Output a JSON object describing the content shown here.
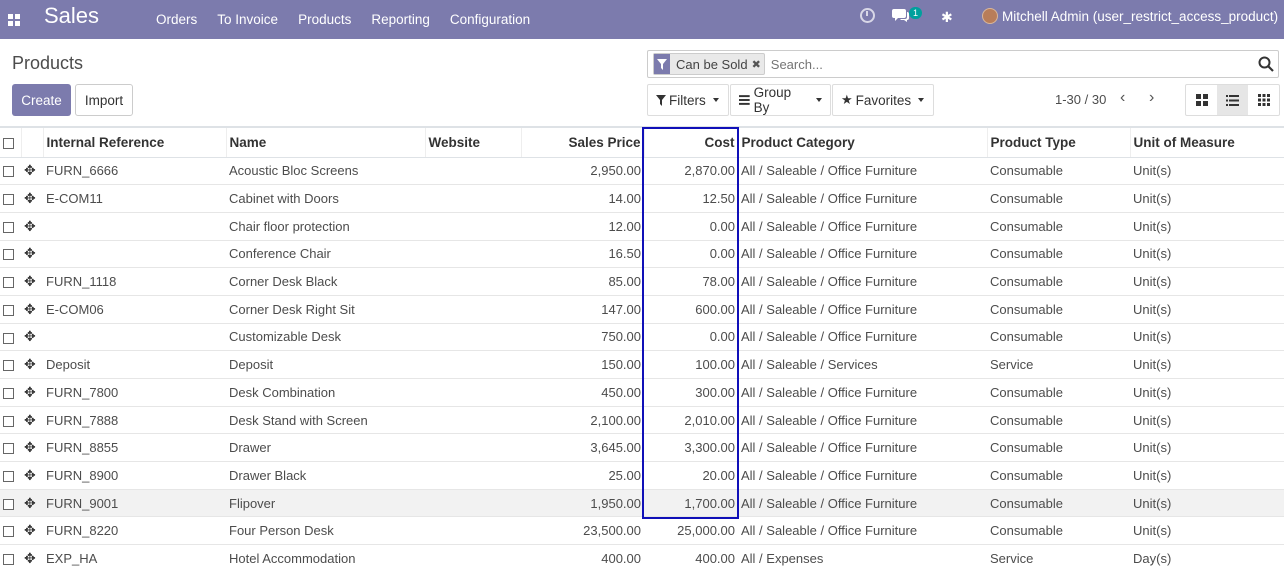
{
  "navbar": {
    "brand": "Sales",
    "menu": [
      "Orders",
      "To Invoice",
      "Products",
      "Reporting",
      "Configuration"
    ],
    "messages_badge": "1",
    "user": "Mitchell Admin (user_restrict_access_product)"
  },
  "control": {
    "breadcrumb": "Products",
    "create_label": "Create",
    "import_label": "Import",
    "facet": "Can be Sold",
    "search_placeholder": "Search...",
    "filters_label": "Filters",
    "groupby_label": "Group By",
    "favorites_label": "Favorites",
    "pager": "1-30 / 30",
    "active_view": "list"
  },
  "table": {
    "columns": [
      "Internal Reference",
      "Name",
      "Website",
      "Sales Price",
      "Cost",
      "Product Category",
      "Product Type",
      "Unit of Measure"
    ],
    "rows": [
      [
        "FURN_6666",
        "Acoustic Bloc Screens",
        "",
        "2,950.00",
        "2,870.00",
        "All / Saleable / Office Furniture",
        "Consumable",
        "Unit(s)"
      ],
      [
        "E-COM11",
        "Cabinet with Doors",
        "",
        "14.00",
        "12.50",
        "All / Saleable / Office Furniture",
        "Consumable",
        "Unit(s)"
      ],
      [
        "",
        "Chair floor protection",
        "",
        "12.00",
        "0.00",
        "All / Saleable / Office Furniture",
        "Consumable",
        "Unit(s)"
      ],
      [
        "",
        "Conference Chair",
        "",
        "16.50",
        "0.00",
        "All / Saleable / Office Furniture",
        "Consumable",
        "Unit(s)"
      ],
      [
        "FURN_1118",
        "Corner Desk Black",
        "",
        "85.00",
        "78.00",
        "All / Saleable / Office Furniture",
        "Consumable",
        "Unit(s)"
      ],
      [
        "E-COM06",
        "Corner Desk Right Sit",
        "",
        "147.00",
        "600.00",
        "All / Saleable / Office Furniture",
        "Consumable",
        "Unit(s)"
      ],
      [
        "",
        "Customizable Desk",
        "",
        "750.00",
        "0.00",
        "All / Saleable / Office Furniture",
        "Consumable",
        "Unit(s)"
      ],
      [
        "Deposit",
        "Deposit",
        "",
        "150.00",
        "100.00",
        "All / Saleable / Services",
        "Service",
        "Unit(s)"
      ],
      [
        "FURN_7800",
        "Desk Combination",
        "",
        "450.00",
        "300.00",
        "All / Saleable / Office Furniture",
        "Consumable",
        "Unit(s)"
      ],
      [
        "FURN_7888",
        "Desk Stand with Screen",
        "",
        "2,100.00",
        "2,010.00",
        "All / Saleable / Office Furniture",
        "Consumable",
        "Unit(s)"
      ],
      [
        "FURN_8855",
        "Drawer",
        "",
        "3,645.00",
        "3,300.00",
        "All / Saleable / Office Furniture",
        "Consumable",
        "Unit(s)"
      ],
      [
        "FURN_8900",
        "Drawer Black",
        "",
        "25.00",
        "20.00",
        "All / Saleable / Office Furniture",
        "Consumable",
        "Unit(s)"
      ],
      [
        "FURN_9001",
        "Flipover",
        "",
        "1,950.00",
        "1,700.00",
        "All / Saleable / Office Furniture",
        "Consumable",
        "Unit(s)"
      ],
      [
        "FURN_8220",
        "Four Person Desk",
        "",
        "23,500.00",
        "25,000.00",
        "All / Saleable / Office Furniture",
        "Consumable",
        "Unit(s)"
      ],
      [
        "EXP_HA",
        "Hotel Accommodation",
        "",
        "400.00",
        "400.00",
        "All / Expenses",
        "Service",
        "Day(s)"
      ]
    ],
    "highlighted_row": 12
  },
  "colors": {
    "brand": "#7c7bad",
    "highlight_frame": "#1010b8"
  }
}
